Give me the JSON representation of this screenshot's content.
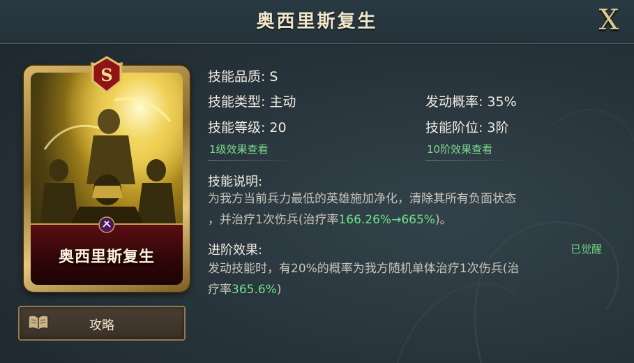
{
  "title": "奥西里斯复生",
  "close_label": "X",
  "card": {
    "grade": "S",
    "name": "奥西里斯复生"
  },
  "guide_button": {
    "label": "攻略"
  },
  "skill": {
    "quality_label": "技能品质:",
    "quality_value": "S",
    "type_label": "技能类型:",
    "type_value": "主动",
    "level_label": "技能等级:",
    "level_value": "20",
    "trigger_label": "发动概率:",
    "trigger_value": "35%",
    "tier_label": "技能阶位:",
    "tier_value": "3阶",
    "link_level1": "1级效果查看",
    "link_tier10": "10阶效果查看"
  },
  "description": {
    "title": "技能说明:",
    "line1": "为我方当前兵力最低的英雄施加净化，清除其所有负面状态",
    "line2_prefix": "，并治疗1次伤兵(治疗率",
    "line2_value": "166.26%→665%",
    "line2_suffix": ")。"
  },
  "advanced": {
    "title": "进阶效果:",
    "status": "已觉醒",
    "line1": "发动技能时，有20%的概率为我方随机单体治疗1次伤兵(治",
    "line2_prefix": "疗率",
    "line2_value": "365.6%",
    "line2_suffix": ")"
  },
  "colors": {
    "highlight_green": "#6fe38a",
    "link_green": "#7fd98f",
    "title_gold": "#efe6cc"
  }
}
